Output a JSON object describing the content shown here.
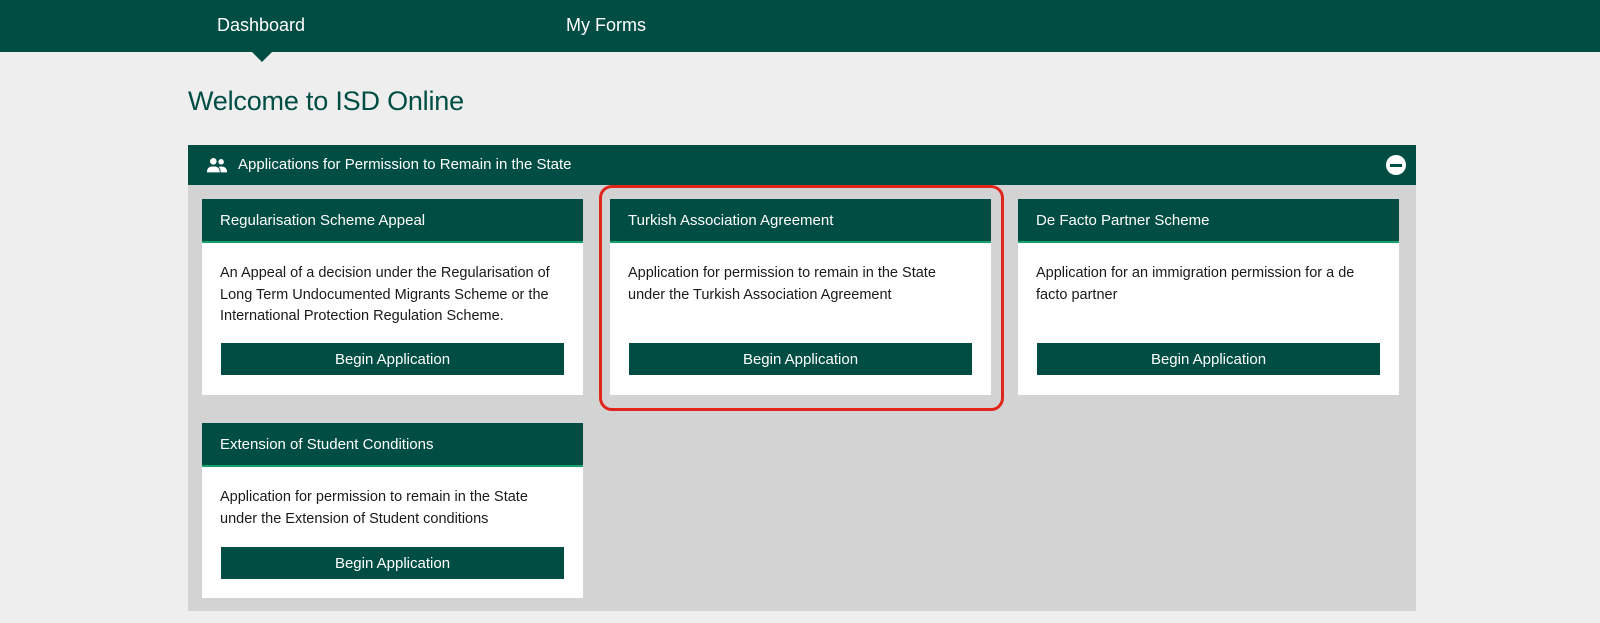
{
  "nav": {
    "items": [
      {
        "label": "Dashboard",
        "active": true
      },
      {
        "label": "My Forms",
        "active": false
      }
    ]
  },
  "page": {
    "title": "Welcome to ISD Online"
  },
  "panel": {
    "title": "Applications for Permission to Remain in the State",
    "icon": "people-icon",
    "collapse_icon": "minus-circle-icon",
    "cards": [
      {
        "title": "Regularisation Scheme Appeal",
        "description": "An Appeal of a decision under the Regularisation of Long Term Undocumented Migrants Scheme or the International Protection Regulation Scheme.",
        "button": "Begin Application"
      },
      {
        "title": "Turkish Association Agreement",
        "description": "Application for permission to remain in the State under the Turkish Association Agreement",
        "button": "Begin Application",
        "highlighted": true
      },
      {
        "title": "De Facto Partner Scheme",
        "description": "Application for an immigration permission for a de facto partner",
        "button": "Begin Application"
      },
      {
        "title": "Extension of Student Conditions",
        "description": "Application for permission to remain in the State under the Extension of Student conditions",
        "button": "Begin Application"
      }
    ]
  },
  "colors": {
    "brand": "#004d44",
    "accent_line": "#19a36a",
    "highlight": "#e0261c",
    "background": "#eeeeee",
    "panel_body": "#d3d3d3"
  }
}
